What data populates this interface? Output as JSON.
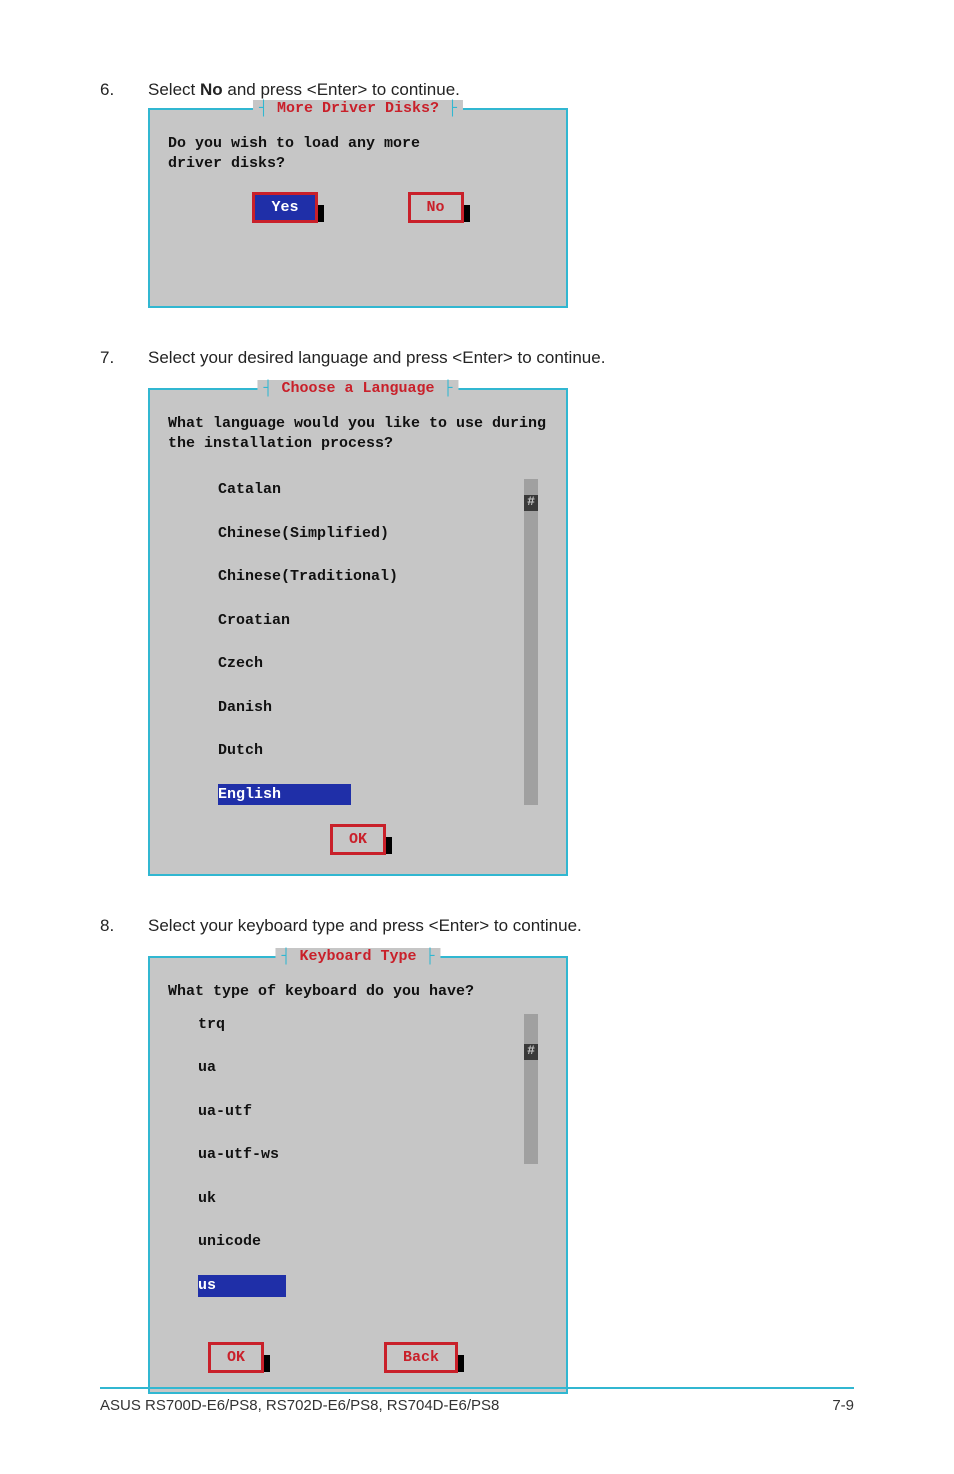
{
  "steps": {
    "s6": {
      "num": "6.",
      "text_pre": "Select ",
      "bold": "No",
      "text_post": " and press <Enter> to continue."
    },
    "s7": {
      "num": "7.",
      "text": "Select your desired language and press <Enter> to continue."
    },
    "s8": {
      "num": "8.",
      "text": "Select your keyboard type and press <Enter> to continue."
    }
  },
  "dialog1": {
    "title": "More Driver Disks?",
    "msg": "Do you wish to load any more driver disks?",
    "btn_yes": "Yes",
    "btn_no": "No"
  },
  "dialog2": {
    "title": "Choose a Language",
    "msg": "What language would you like to use during the installation process?",
    "items": [
      "Catalan",
      "Chinese(Simplified)",
      "Chinese(Traditional)",
      "Croatian",
      "Czech",
      "Danish",
      "Dutch",
      "English"
    ],
    "selected_index": 7,
    "thumb_char": "#",
    "btn_ok": "OK"
  },
  "dialog3": {
    "title": "Keyboard Type",
    "msg": "What type of keyboard do you have?",
    "items": [
      "trq",
      "ua",
      "ua-utf",
      "ua-utf-ws",
      "uk",
      "unicode",
      "us"
    ],
    "selected_index": 6,
    "thumb_char": "#",
    "btn_ok": "OK",
    "btn_back": "Back"
  },
  "footer": {
    "left": "ASUS RS700D-E6/PS8, RS702D-E6/PS8, RS704D-E6/PS8",
    "right": "7-9"
  }
}
